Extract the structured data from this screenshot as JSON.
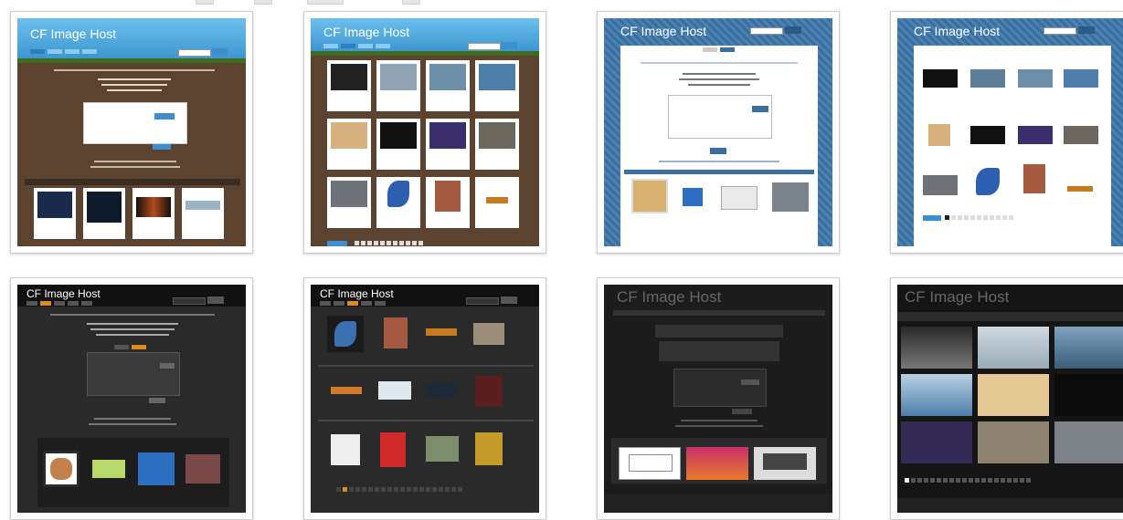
{
  "gallery": {
    "themes": [
      {
        "id": "brown-earth",
        "logo": "CF Image Host"
      },
      {
        "id": "sky-grid",
        "logo": "CF Image Host"
      },
      {
        "id": "blue-stripe-upload",
        "logo": "CF Image Host"
      },
      {
        "id": "blue-stripe-gallery",
        "logo": "CF Image Host"
      },
      {
        "id": "dark-upload",
        "logo": "CF Image Host"
      },
      {
        "id": "dark-grid",
        "logo": "CF Image Host"
      },
      {
        "id": "charcoal-upload",
        "logo": "CF Image Host"
      },
      {
        "id": "black-gallery",
        "logo": "CF Image Host"
      }
    ]
  },
  "colors": {
    "sky": "#5aaee0",
    "earth": "#5b4330",
    "grass": "#3f6b1f",
    "stripe_blue": "#3a6f9e",
    "dark": "#1d1d1d",
    "accent_orange": "#e08a1e",
    "link_blue": "#3a8fd6"
  }
}
